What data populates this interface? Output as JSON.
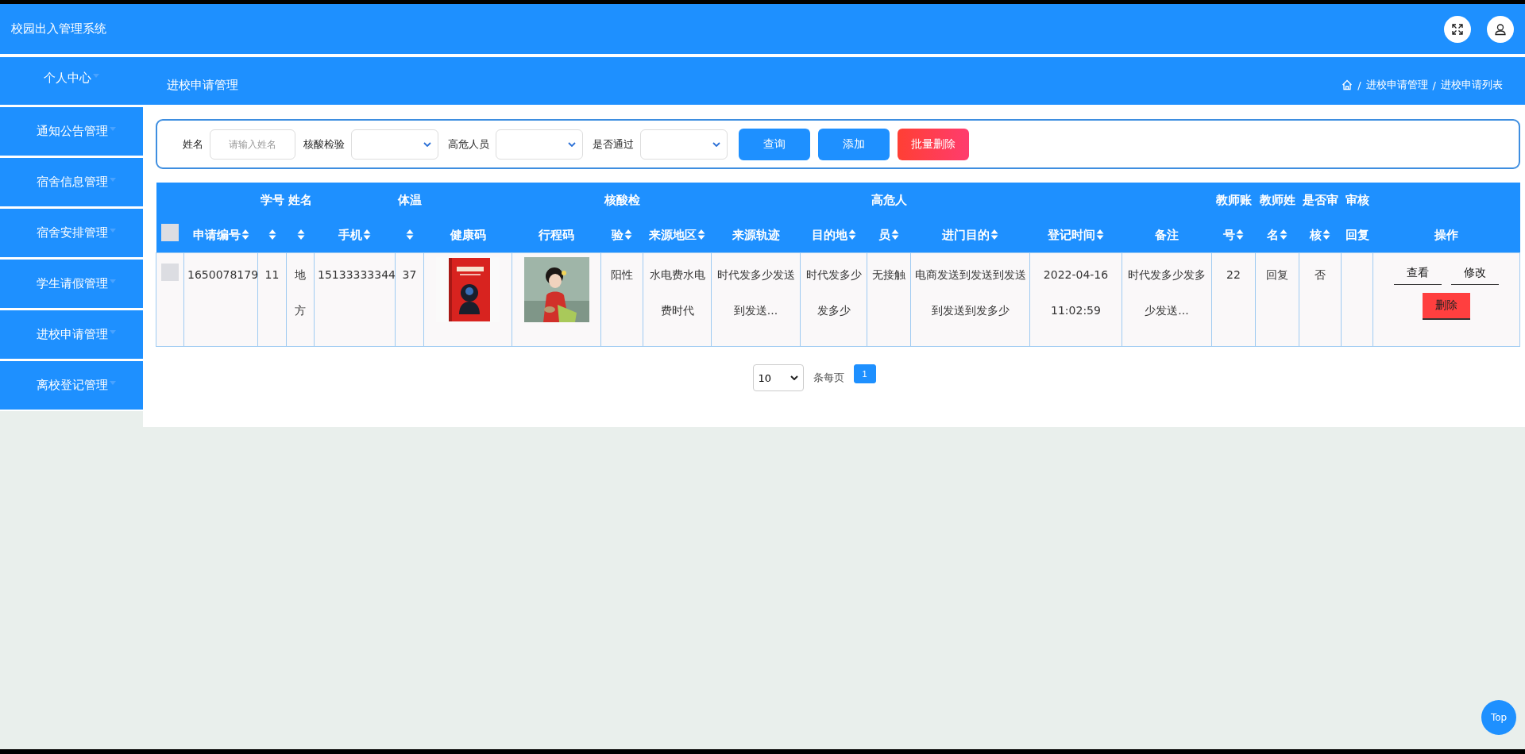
{
  "app_title": "校园出入管理系统",
  "sidebar": {
    "items": [
      {
        "label": "个人中心"
      },
      {
        "label": "通知公告管理"
      },
      {
        "label": "宿舍信息管理"
      },
      {
        "label": "宿舍安排管理"
      },
      {
        "label": "学生请假管理"
      },
      {
        "label": "进校申请管理"
      },
      {
        "label": "离校登记管理"
      }
    ]
  },
  "page_title": "进校申请管理",
  "breadcrumb": {
    "separator": "/",
    "items": [
      "进校申请管理",
      "进校申请列表"
    ]
  },
  "filters": [
    {
      "label": "姓名",
      "kind": "input",
      "placeholder": "请输入姓名"
    },
    {
      "label": "核酸检验",
      "kind": "select"
    },
    {
      "label": "高危人员",
      "kind": "select"
    },
    {
      "label": "是否通过",
      "kind": "select"
    }
  ],
  "actions": [
    {
      "label": "查询",
      "kind": "primary"
    },
    {
      "label": "添加",
      "kind": "primary"
    },
    {
      "label": "批量删除",
      "kind": "danger"
    }
  ],
  "table": {
    "select_all": {
      "checked": false
    },
    "columns": [
      {
        "label": "申请编号",
        "sortable": true
      },
      {
        "label": "学号",
        "sortable": true
      },
      {
        "label": "姓名",
        "sortable": true
      },
      {
        "label": "手机",
        "sortable": true
      },
      {
        "label": "体温",
        "sortable": true
      },
      {
        "label": "健康码",
        "sortable": false
      },
      {
        "label": "行程码",
        "sortable": false
      },
      {
        "label": "核酸检验",
        "sortable": true
      },
      {
        "label": "来源地区",
        "sortable": true
      },
      {
        "label": "来源轨迹",
        "sortable": false
      },
      {
        "label": "目的地",
        "sortable": true
      },
      {
        "label": "高危人员",
        "sortable": true
      },
      {
        "label": "进门目的",
        "sortable": true
      },
      {
        "label": "登记时间",
        "sortable": true
      },
      {
        "label": "备注",
        "sortable": false
      },
      {
        "label": "教师账号",
        "sortable": true
      },
      {
        "label": "教师姓名",
        "sortable": true
      },
      {
        "label": "是否审核",
        "sortable": true
      },
      {
        "label": "审核回复",
        "sortable": false
      },
      {
        "label": "操作",
        "sortable": false
      }
    ],
    "rows": [
      {
        "checked": false,
        "cells": [
          {
            "kind": "text",
            "text": "1650078179"
          },
          {
            "kind": "text",
            "text": "11"
          },
          {
            "kind": "text",
            "text": "地方"
          },
          {
            "kind": "text",
            "text": "15133333344"
          },
          {
            "kind": "text",
            "text": "37"
          },
          {
            "kind": "picture"
          },
          {
            "kind": "picture"
          },
          {
            "kind": "text",
            "text": "阳性"
          },
          {
            "kind": "text",
            "text": "水电费水电费时代"
          },
          {
            "kind": "text",
            "text": "时代发多少发送到发送..."
          },
          {
            "kind": "text",
            "text": "时代发多少发多少"
          },
          {
            "kind": "text",
            "text": "无接触"
          },
          {
            "kind": "text",
            "text": "电商发送到发送到发送到发送到发多少"
          },
          {
            "kind": "text",
            "text": "2022-04-16 11:02:59"
          },
          {
            "kind": "text",
            "text": "时代发多少发多少发送..."
          },
          {
            "kind": "text",
            "text": "22"
          },
          {
            "kind": "text",
            "text": "回复"
          },
          {
            "kind": "text",
            "text": "否"
          },
          {
            "kind": "blank"
          }
        ],
        "actions": [
          {
            "label": "查看",
            "kind": "link"
          },
          {
            "label": "修改",
            "kind": "link"
          },
          {
            "label": "删除",
            "kind": "danger"
          }
        ]
      }
    ]
  },
  "pagination": {
    "page_size": "10",
    "suffix": "条每页",
    "pages": [
      {
        "label": "1",
        "selected": true
      }
    ]
  },
  "back_to_top": "Top"
}
